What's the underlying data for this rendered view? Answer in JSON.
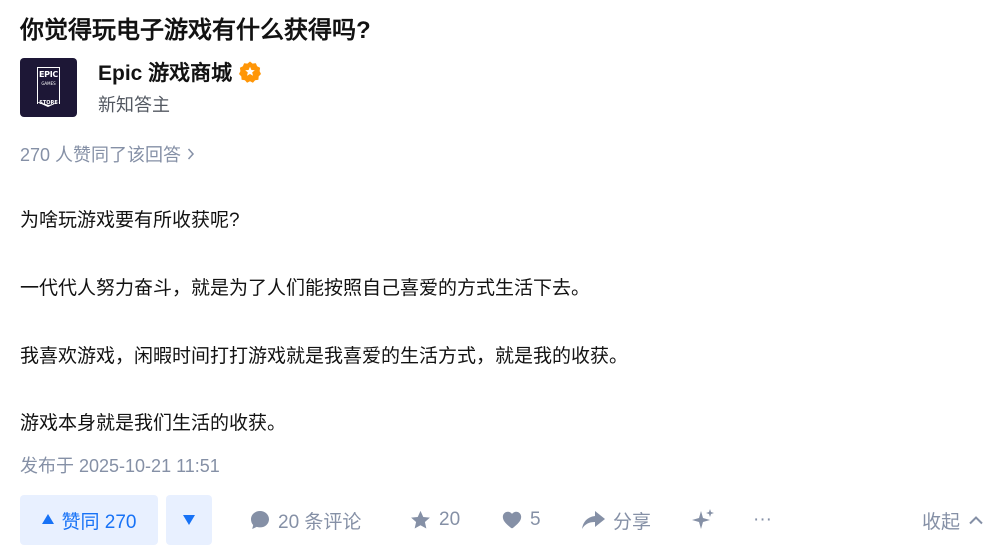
{
  "question": {
    "title": "你觉得玩电子游戏有什么获得吗?"
  },
  "author": {
    "name": "Epic 游戏商城",
    "tag": "新知答主",
    "avatar_text": {
      "line1": "EPIC",
      "line2": "GAMES",
      "line3": "STORE"
    },
    "badge_icon": "verified-badge-icon",
    "badge_color": "#ff9607"
  },
  "answer": {
    "voters_text": "270 人赞同了该回答",
    "paragraphs": [
      "为啥玩游戏要有所收获呢?",
      "一代代人努力奋斗，就是为了人们能按照自己喜爱的方式生活下去。",
      "我喜欢游戏，闲暇时间打打游戏就是我喜爱的生活方式，就是我的收获。",
      "游戏本身就是我们生活的收获。"
    ],
    "published": "发布于 2025-10-21 11:51"
  },
  "actions": {
    "vote_up_label": "赞同 270",
    "comment_label": "20 条评论",
    "favorite_count": "20",
    "like_count": "5",
    "share_label": "分享",
    "more_label": "···",
    "collapse_label": "收起"
  },
  "colors": {
    "brand_blue": "#1772f6",
    "vote_bg": "#e8f0ff",
    "muted_text": "#8590a6",
    "avatar_bg": "#1d1736"
  }
}
